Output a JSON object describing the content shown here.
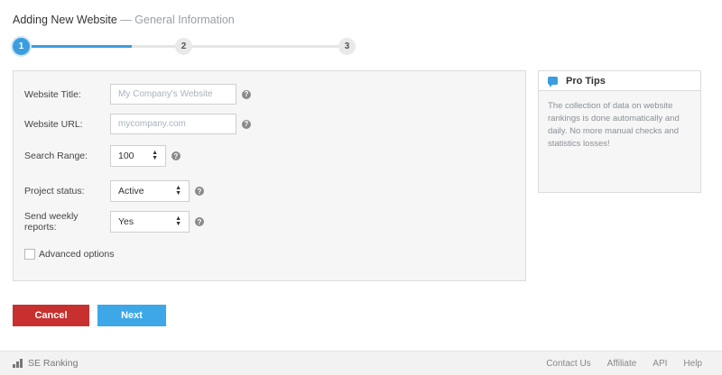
{
  "header": {
    "title": "Adding New Website",
    "subtitle": "— General Information"
  },
  "stepper": {
    "steps": [
      "1",
      "2",
      "3"
    ],
    "current": 1
  },
  "form": {
    "website_title": {
      "label": "Website Title:",
      "placeholder": "My Company's Website",
      "value": ""
    },
    "website_url": {
      "label": "Website URL:",
      "placeholder": "mycompany.com",
      "value": ""
    },
    "search_range": {
      "label": "Search Range:",
      "value": "100"
    },
    "project_status": {
      "label": "Project status:",
      "value": "Active"
    },
    "weekly_reports": {
      "label": "Send weekly reports:",
      "value": "Yes"
    },
    "advanced_options": {
      "label": "Advanced options",
      "checked": false
    },
    "help_glyph": "?"
  },
  "tips": {
    "title": "Pro Tips",
    "body": "The collection of data on website rankings is done automatically and daily. No more manual checks and statistics losses!"
  },
  "buttons": {
    "cancel": "Cancel",
    "next": "Next"
  },
  "footer": {
    "brand": "SE Ranking",
    "links": [
      "Contact Us",
      "Affiliate",
      "API",
      "Help"
    ]
  },
  "colors": {
    "accent": "#3b9de0",
    "cancel": "#c7302f",
    "next": "#3ea7e8"
  }
}
